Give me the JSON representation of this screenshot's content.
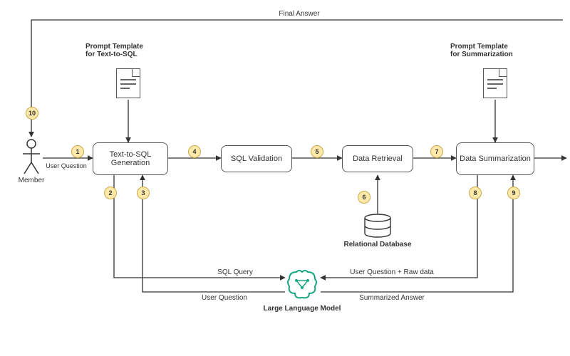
{
  "actor": {
    "label": "Member"
  },
  "prompts": {
    "left": {
      "title": "Prompt Template\nfor Text-to-SQL"
    },
    "right": {
      "title": "Prompt Template\nfor Summarization"
    }
  },
  "boxes": {
    "gen": "Text-to-SQL\nGeneration",
    "val": "SQL Validation",
    "ret": "Data Retrieval",
    "sum": "Data Summarization"
  },
  "components": {
    "db": "Relational Database",
    "llm": "Large Language Model"
  },
  "edges": {
    "final": "Final Answer",
    "user_question": "User Question",
    "sql_query": "SQL Query",
    "uq_raw": "User Question + Raw data",
    "summarized": "Summarized Answer"
  },
  "steps": {
    "1": "1",
    "2": "2",
    "3": "3",
    "4": "4",
    "5": "5",
    "6": "6",
    "7": "7",
    "8": "8",
    "9": "9",
    "10": "10"
  }
}
